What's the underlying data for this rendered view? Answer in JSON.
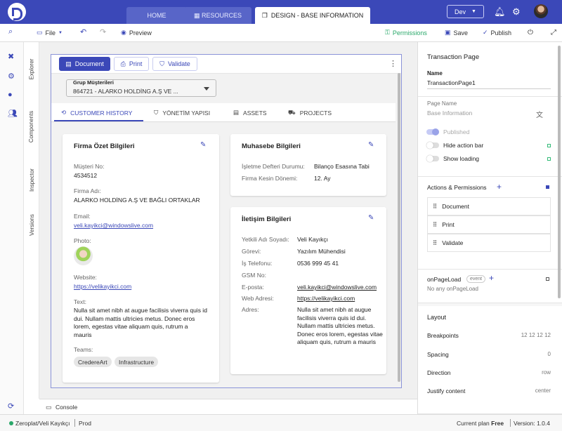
{
  "topbar": {
    "tabs": [
      {
        "label": "HOME"
      },
      {
        "label": "RESOURCES"
      },
      {
        "label": "DESIGN - BASE INFORMATION"
      }
    ],
    "env": "Dev",
    "accent": "#3b48b8"
  },
  "toolbar": {
    "file": "File",
    "preview": "Preview",
    "permissions": "Permissions",
    "save": "Save",
    "publish": "Publish"
  },
  "sidetabs": [
    "Explorer",
    "Components",
    "Inspector",
    "Versions"
  ],
  "page": {
    "buttons": {
      "document": "Document",
      "print": "Print",
      "validate": "Validate"
    },
    "select": {
      "label": "Grup Müşterileri",
      "value": "864721 - ALARKO HOLDİNG A.Ş VE ..."
    },
    "tabs": [
      "CUSTOMER HISTORY",
      "YÖNETİM YAPISI",
      "ASSETS",
      "PROJECTS"
    ],
    "summary": {
      "title": "Firma Özet Bilgileri",
      "customer_no_label": "Müşteri No:",
      "customer_no": "4534512",
      "company_label": "Firma Adı:",
      "company": "ALARKO HOLDİNG A.Ş VE BAĞLI ORTAKLAR",
      "email_label": "Email:",
      "email": "veli.kayikci@windowslive.com",
      "photo_label": "Photo:",
      "website_label": "Website:",
      "website": "https://velikayikci.com",
      "text_label": "Text:",
      "text": "Nulla sit amet nibh at augue facilisis viverra quis id dui. Nullam mattis ultricies metus. Donec eros lorem, egestas vitae aliquam quis, rutrum a mauris",
      "teams_label": "Teams:",
      "teams": [
        "CredereArt",
        "Infrastructure"
      ]
    },
    "accounting": {
      "title": "Muhasebe Bilgileri",
      "book_label": "İşletme Defteri Durumu:",
      "book_value": "Bilanço Esasına Tabi",
      "period_label": "Firma Kesin Dönemi:",
      "period_value": "12. Ay"
    },
    "contact": {
      "title": "İletişim Bilgileri",
      "rows": [
        {
          "label": "Yetkili Adı Soyadı:",
          "value": "Veli Kayıkçı"
        },
        {
          "label": "Görevi:",
          "value": "Yazılım Mühendisi"
        },
        {
          "label": "İş Telefonu:",
          "value": "0536 999 45 41"
        },
        {
          "label": "GSM No:",
          "value": ""
        },
        {
          "label": "E-posta:",
          "value": "veli.kayikci@windowslive.com"
        },
        {
          "label": "Web Adresi:",
          "value": "https://velikayikci.com"
        },
        {
          "label": "Adres:",
          "value": "Nulla sit amet nibh at augue facilisis viverra quis id dui. Nullam mattis ultricies metus. Donec eros lorem, egestas vitae aliquam quis, rutrum a mauris"
        }
      ]
    }
  },
  "panel": {
    "title": "Transaction Page",
    "name_label": "Name",
    "name_value": "TransactionPage1",
    "page_name_label": "Page Name",
    "page_name_placeholder": "Base Information",
    "published": "Published",
    "hide_action_bar": "Hide action bar",
    "show_loading": "Show loading",
    "actions_title": "Actions & Permissions",
    "actions": [
      "Document",
      "Print",
      "Validate"
    ],
    "onpageload": "onPageLoad",
    "event_badge": "event",
    "onpageload_empty": "No any onPageLoad",
    "layout_title": "Layout",
    "layout": [
      {
        "label": "Breakpoints",
        "value": "12 12 12 12"
      },
      {
        "label": "Spacing",
        "value": "0"
      },
      {
        "label": "Direction",
        "value": "row"
      },
      {
        "label": "Justify content",
        "value": "center"
      }
    ]
  },
  "console": "Console",
  "status": {
    "user": "Zeroplat/Veli Kayıkçı",
    "env": "Prod",
    "plan_prefix": "Current plan",
    "plan": "Free",
    "version": "Version: 1.0.4"
  }
}
